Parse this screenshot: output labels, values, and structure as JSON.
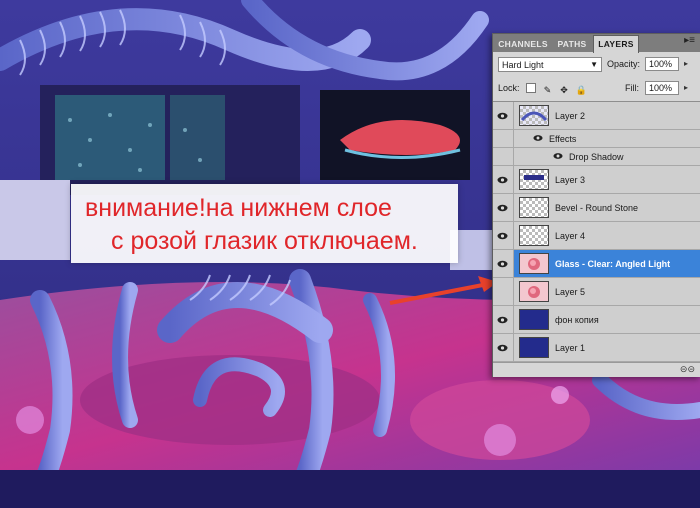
{
  "annotation": {
    "line1": "внимание!на нижнем слое",
    "line2": "с розой глазик отключаем."
  },
  "colors": {
    "annotation_text": "#e0262a",
    "arrow": "#e8412b",
    "selected_row": "#3b83d9",
    "art_violet": "#6f7ad6",
    "art_magenta": "#c6338e"
  },
  "panel": {
    "tabs": [
      {
        "label": "CHANNELS",
        "active": false
      },
      {
        "label": "PATHS",
        "active": false
      },
      {
        "label": "LAYERS",
        "active": true
      }
    ],
    "collapse_icon": "panel-menu-icon",
    "blend_mode": "Hard Light",
    "opacity_label": "Opacity:",
    "opacity_value": "100%",
    "lock_label": "Lock:",
    "fill_label": "Fill:",
    "fill_value": "100%",
    "layers": [
      {
        "name": "Layer 2",
        "visible": true,
        "thumb": "pattern",
        "selected": false
      },
      {
        "name": "Effects",
        "sub": true,
        "visible": true
      },
      {
        "name": "Drop Shadow",
        "sub": true,
        "visible": true
      },
      {
        "name": "Layer 3",
        "visible": true,
        "thumb": "transparent-blue",
        "selected": false
      },
      {
        "name": "Bevel - Round Stone",
        "visible": true,
        "thumb": "transparent",
        "selected": false
      },
      {
        "name": "Layer 4",
        "visible": true,
        "thumb": "transparent",
        "selected": false
      },
      {
        "name": "Glass - Clear: Angled Light",
        "visible": true,
        "thumb": "rose",
        "selected": true
      },
      {
        "name": "Layer 5",
        "visible": false,
        "thumb": "rose",
        "selected": false
      },
      {
        "name": "фон копия",
        "visible": true,
        "thumb": "navy",
        "selected": false
      },
      {
        "name": "Layer 1",
        "visible": true,
        "thumb": "navy",
        "selected": false
      }
    ],
    "footer_icon": "link-layers-icon"
  }
}
